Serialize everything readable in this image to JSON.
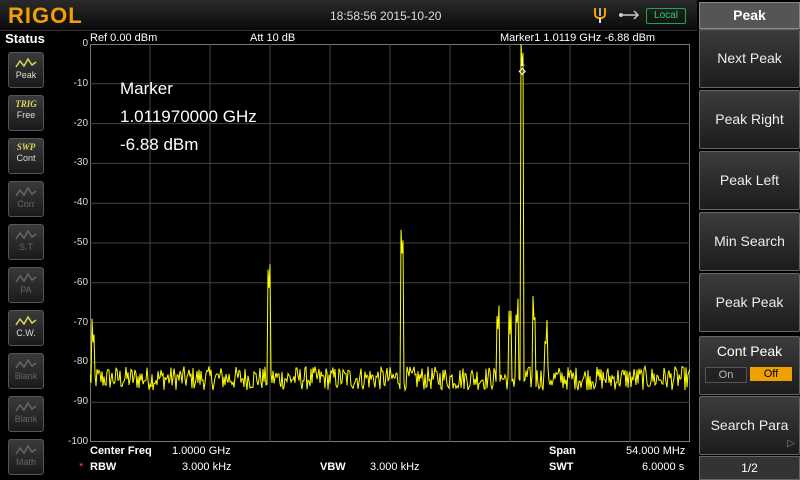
{
  "topbar": {
    "logo": "RIGOL",
    "datetime": "18:58:56 2015-10-20",
    "local_label": "Local"
  },
  "status": {
    "title": "Status",
    "buttons": [
      {
        "top": "",
        "bottom": "Peak",
        "icon": "peak-wave-icon",
        "active": true
      },
      {
        "top": "TRIG",
        "bottom": "Free",
        "active": true
      },
      {
        "top": "SWP",
        "bottom": "Cont",
        "active": true
      },
      {
        "top": "",
        "bottom": "Corr",
        "icon": "corr-icon",
        "active": false
      },
      {
        "top": "",
        "bottom": "S.T",
        "icon": "st-icon",
        "active": false
      },
      {
        "top": "",
        "bottom": "PA",
        "icon": "pa-icon",
        "active": false
      },
      {
        "top": "",
        "bottom": "C.W.",
        "icon": "cw-icon",
        "active": true
      },
      {
        "top": "",
        "bottom": "Blank",
        "icon": "blank-icon",
        "active": false
      },
      {
        "top": "",
        "bottom": "Blank",
        "icon": "blank-icon",
        "active": false
      },
      {
        "top": "",
        "bottom": "Math",
        "icon": "math-icon",
        "active": false
      }
    ]
  },
  "header": {
    "ref": "Ref  0.00 dBm",
    "att": "Att      10 dB",
    "marker": "Marker1   1.0119 GHz   -6.88 dBm"
  },
  "y_ticks": [
    "0",
    "-10",
    "-20",
    "-30",
    "-40",
    "-50",
    "-60",
    "-70",
    "-80",
    "-90",
    "-100"
  ],
  "marker_readout": {
    "title": "Marker",
    "freq": "1.011970000 GHz",
    "level": "-6.88 dBm",
    "marker_number": "1"
  },
  "footer": {
    "center_label": "Center Freq",
    "center_value": "1.0000 GHz",
    "span_label": "Span",
    "span_value": "54.000 MHz",
    "rbw_star": "*",
    "rbw_label": "RBW",
    "rbw_value": "3.000 kHz",
    "vbw_label": "VBW",
    "vbw_value": "3.000 kHz",
    "swt_label": "SWT",
    "swt_value": "6.0000 s"
  },
  "menu": {
    "title": "Peak",
    "items": [
      "Next Peak",
      "Peak Right",
      "Peak Left",
      "Min Search",
      "Peak Peak"
    ],
    "cont_peak": {
      "label": "Cont Peak",
      "on": "On",
      "off": "Off",
      "selected": "Off"
    },
    "search_para": "Search Para",
    "page": "1/2"
  },
  "colors": {
    "trace": "#ffff00",
    "accent": "#f0a000",
    "local": "#2bd46a"
  },
  "chart_data": {
    "type": "line",
    "xlabel": "",
    "ylabel": "",
    "ylim": [
      -100,
      0
    ],
    "xlim_ghz": [
      0.973,
      1.027
    ],
    "noise_floor_dbm": -84,
    "peaks": [
      {
        "freq_ghz": 0.9733,
        "level_dbm": -77
      },
      {
        "freq_ghz": 0.9891,
        "level_dbm": -62
      },
      {
        "freq_ghz": 1.0011,
        "level_dbm": -54
      },
      {
        "freq_ghz": 1.0097,
        "level_dbm": -73
      },
      {
        "freq_ghz": 1.0108,
        "level_dbm": -73
      },
      {
        "freq_ghz": 1.0114,
        "level_dbm": -72
      },
      {
        "freq_ghz": 1.0119,
        "level_dbm": -6.88
      },
      {
        "freq_ghz": 1.013,
        "level_dbm": -72
      },
      {
        "freq_ghz": 1.014,
        "level_dbm": -78
      }
    ]
  }
}
